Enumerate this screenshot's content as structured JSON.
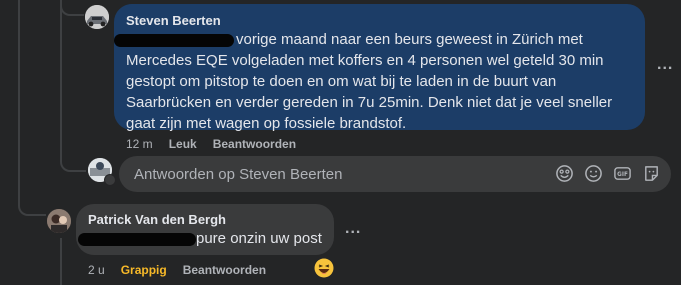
{
  "comment_1": {
    "author": "Steven Beerten",
    "text": "vorige maand naar een beurs geweest in Zürich met Mercedes EQE volgeladen met koffers en 4 personen wel geteld 30 min gestopt om pitstop te doen en om wat bij te laden in de buurt van Saarbrücken en verder gereden in 7u 25min. Denk niet dat je veel sneller gaat zijn met wagen op fossiele brandstof.",
    "text_line1": "vorige maand naar een beurs geweest in Zürich met",
    "text_line2": "Mercedes EQE volgeladen met koffers en 4 personen wel geteld 30 min",
    "text_line3": "gestopt om pitstop te doen en om wat bij te laden in de buurt van",
    "text_line4": "Saarbrücken en verder gereden in 7u 25min. Denk niet dat je veel sneller",
    "text_line5": "gaat zijn met wagen op fossiele brandstof.",
    "time": "12 m",
    "like_label": "Leuk",
    "reply_label": "Beantwoorden",
    "more_label": "..."
  },
  "reply_box": {
    "placeholder": "Antwoorden op Steven Beerten",
    "icons": [
      "sticker-icon",
      "emoji-icon",
      "gif-icon",
      "camera-sticker-icon"
    ]
  },
  "comment_2": {
    "author": "Patrick Van den Bergh",
    "text": "pure onzin uw post",
    "time": "2 u",
    "reaction_label": "Grappig",
    "reply_label": "Beantwoorden",
    "more_label": "...",
    "reaction_emoji": "haha-icon"
  },
  "colors": {
    "background": "#242526",
    "bubble_self": "#1c3d67",
    "bubble_other": "#3a3b3c",
    "reaction_funny": "#f7b928"
  }
}
